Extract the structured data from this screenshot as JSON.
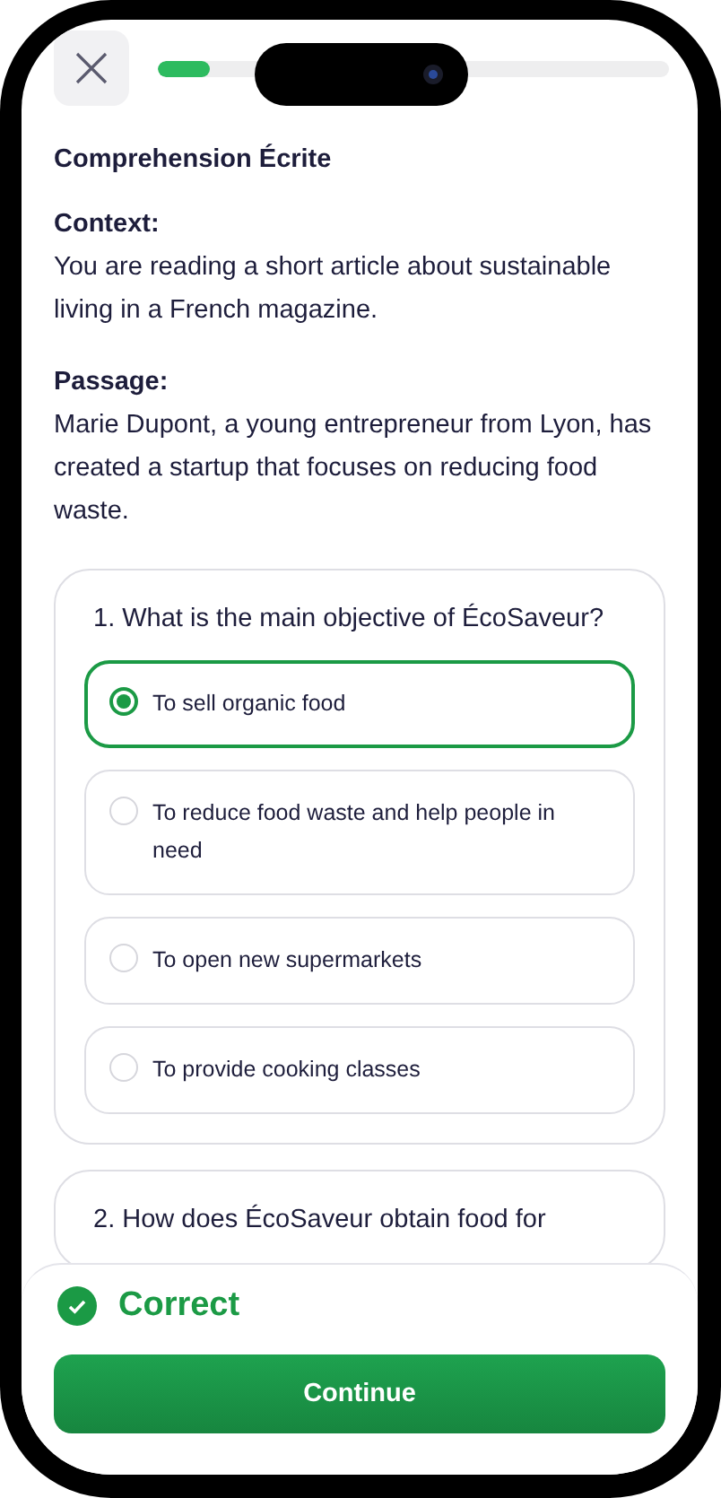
{
  "progress": {
    "level": 0.1
  },
  "title": "Comprehension Écrite",
  "sections": [
    {
      "label": "Context:",
      "text": "You are reading a short article about sustainable living in a French magazine."
    },
    {
      "label": "Passage:",
      "text": "Marie Dupont, a young entrepreneur from Lyon, has created a startup that focuses on reducing food waste."
    }
  ],
  "questions": [
    {
      "text": "1. What is the main objective of ÉcoSaveur?",
      "options": [
        {
          "label": "To sell organic food",
          "selected": true
        },
        {
          "label": "To reduce food waste and help people in need",
          "selected": false
        },
        {
          "label": "To open new supermarkets",
          "selected": false
        },
        {
          "label": "To provide cooking classes",
          "selected": false
        }
      ]
    },
    {
      "text": "2. How does ÉcoSaveur obtain food for"
    }
  ],
  "feedback": {
    "correct": true,
    "label": "Correct"
  },
  "continue_button": "Continue"
}
